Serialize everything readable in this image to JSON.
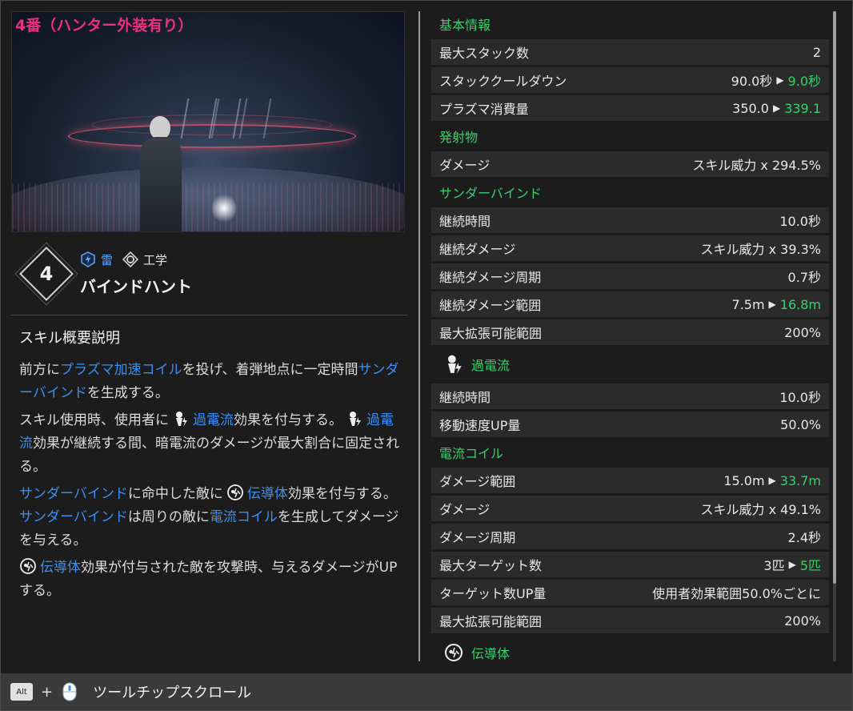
{
  "preview": {
    "label": "4番（ハンター外装有り）"
  },
  "skill": {
    "number": "4",
    "element_tag": "雷",
    "category_tag": "工学",
    "name": "バインドハント"
  },
  "description": {
    "heading": "スキル概要説明",
    "p1": {
      "a": "前方に",
      "k1": "プラズマ加速コイル",
      "b": "を投げ、着弾地点に一定時間",
      "k2": "サンダーバインド",
      "c": "を生成する。"
    },
    "p2": {
      "a": "スキル使用時、使用者に",
      "k1": "過電流",
      "b": "効果を付与する。",
      "k2": "過電流",
      "c": "効果が継続する間、暗電流のダメージが最大割合に固定される。"
    },
    "p3": {
      "k1": "サンダーバインド",
      "a": "に命中した敵に",
      "k2": "伝導体",
      "b": "効果を付与する。",
      "k3": "サンダーバインド",
      "c": "は周りの敵に",
      "k4": "電流コイル",
      "d": "を生成してダメージを与える。"
    },
    "p4": {
      "k1": "伝導体",
      "a": "効果が付与された敵を攻撃時、与えるダメージがUPする。"
    }
  },
  "stats": {
    "s1": "基本情報",
    "r1": {
      "label": "最大スタック数",
      "value": "2"
    },
    "r2": {
      "label": "スタッククールダウン",
      "from": "90.0秒",
      "to": "9.0秒"
    },
    "r3": {
      "label": "プラズマ消費量",
      "from": "350.0",
      "to": "339.1"
    },
    "s2": "発射物",
    "r4": {
      "label": "ダメージ",
      "value": "スキル威力 x 294.5%"
    },
    "s3": "サンダーバインド",
    "r5": {
      "label": "継続時間",
      "value": "10.0秒"
    },
    "r6": {
      "label": "継続ダメージ",
      "value": "スキル威力 x 39.3%"
    },
    "r7": {
      "label": "継続ダメージ周期",
      "value": "0.7秒"
    },
    "r8": {
      "label": "継続ダメージ範囲",
      "from": "7.5m",
      "to": "16.8m"
    },
    "r9": {
      "label": "最大拡張可能範囲",
      "value": "200%"
    },
    "s4": "過電流",
    "r10": {
      "label": "継続時間",
      "value": "10.0秒"
    },
    "r11": {
      "label": "移動速度UP量",
      "value": "50.0%"
    },
    "s5": "電流コイル",
    "r12": {
      "label": "ダメージ範囲",
      "from": "15.0m",
      "to": "33.7m"
    },
    "r13": {
      "label": "ダメージ",
      "value": "スキル威力 x 49.1%"
    },
    "r14": {
      "label": "ダメージ周期",
      "value": "2.4秒"
    },
    "r15": {
      "label": "最大ターゲット数",
      "from": "3匹",
      "to": "5匹"
    },
    "r16": {
      "label": "ターゲット数UP量",
      "value": "使用者効果範囲50.0%ごとに"
    },
    "r17": {
      "label": "最大拡張可能範囲",
      "value": "200%"
    },
    "s6": "伝導体"
  },
  "footer": {
    "alt_key": "Alt",
    "plus": "+",
    "label": "ツールチップスクロール"
  },
  "colors": {
    "accent_green": "#38d16a",
    "keyword_blue": "#3b8ff3",
    "preview_label": "#ee2f7c"
  },
  "icons": [
    "electric-icon",
    "engineering-icon",
    "overcurrent-icon",
    "conductor-icon",
    "mouse-wheel-icon"
  ]
}
